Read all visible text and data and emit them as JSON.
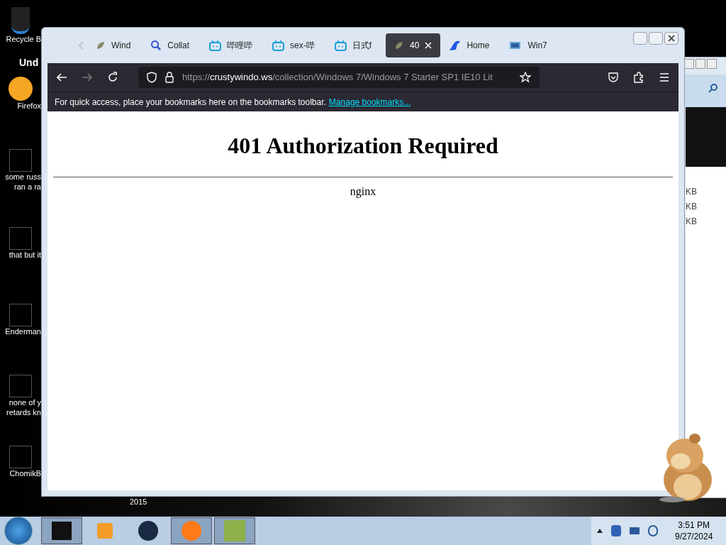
{
  "desktop": {
    "icons": [
      {
        "label": "Recycle B",
        "kind": "bin"
      },
      {
        "label": "Und",
        "kind": "text"
      },
      {
        "label": "Firefox",
        "kind": "fox"
      },
      {
        "label": "some russ ran a ra",
        "kind": "app"
      },
      {
        "label": "that but it",
        "kind": "app"
      },
      {
        "label": "Enderman",
        "kind": "app"
      },
      {
        "label": "none of y retards kn",
        "kind": "app"
      },
      {
        "label": "ChomikB",
        "kind": "app"
      }
    ],
    "year_label": "2015"
  },
  "browser": {
    "tabs": [
      {
        "label": "Wind",
        "kind": "leaf",
        "selected": false
      },
      {
        "label": "Collat",
        "kind": "search",
        "selected": false
      },
      {
        "label": "哔哩哔",
        "kind": "tv",
        "selected": false
      },
      {
        "label": "sex-哔",
        "kind": "tv",
        "selected": false
      },
      {
        "label": "日式f",
        "kind": "tv",
        "selected": false
      },
      {
        "label": "40",
        "kind": "leaf",
        "selected": true
      },
      {
        "label": "Home",
        "kind": "bird",
        "selected": false
      },
      {
        "label": "Win7",
        "kind": "win",
        "selected": false
      }
    ],
    "url": {
      "domain": "crustywindo.ws",
      "path": "/collection/Windows 7/Windows 7 Starter SP1 IE10 Lit",
      "prefix": "https://"
    },
    "bookmarks_hint": "For quick access, place your bookmarks here on the bookmarks toolbar.",
    "bookmarks_link": "Manage bookmarks...",
    "page": {
      "heading": "401 Authorization Required",
      "server": "nginx"
    }
  },
  "back_window": {
    "sizes": [
      "KB",
      "KB",
      "KB"
    ]
  },
  "taskbar": {
    "time": "3:51 PM",
    "date": "9/27/2024"
  }
}
